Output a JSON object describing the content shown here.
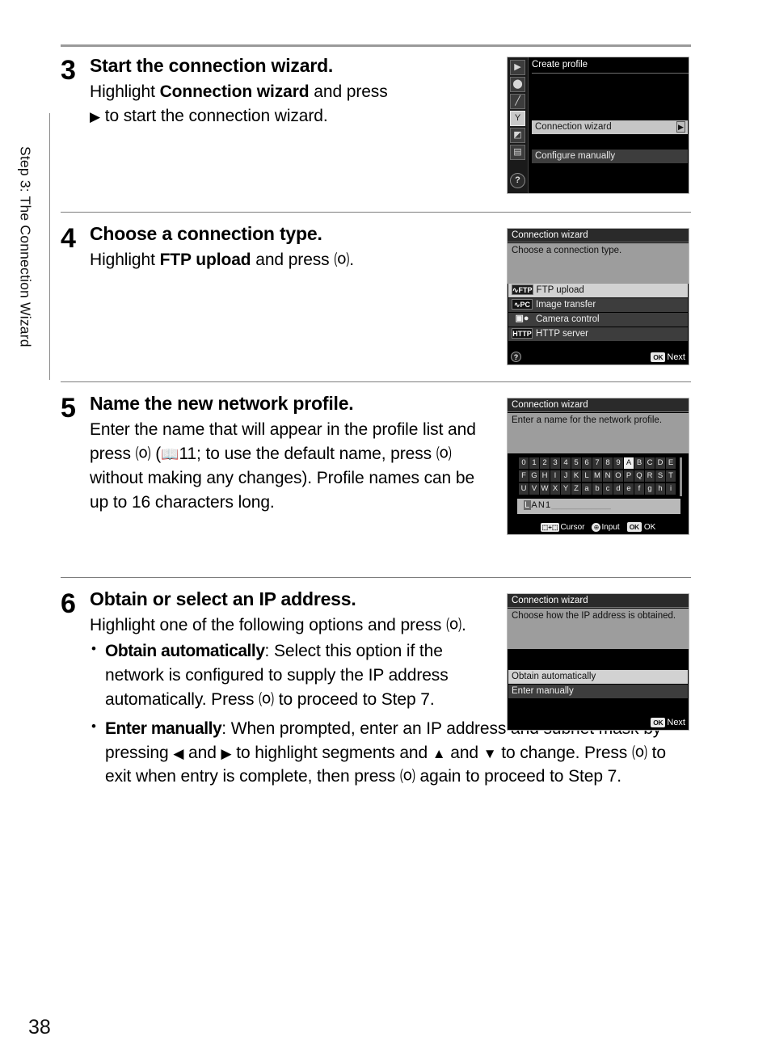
{
  "page": {
    "number": "38",
    "side_tab": "Step 3: The Connection Wizard"
  },
  "steps": [
    {
      "number": "3",
      "title": "Start the connection wizard.",
      "body_prefix": "Highlight ",
      "body_bold": "Connection wizard",
      "body_suffix": " and press ",
      "body_line2_arrow": "▶",
      "body_line2": " to start the connection wizard."
    },
    {
      "number": "4",
      "title": "Choose a connection type.",
      "body_prefix": "Highlight ",
      "body_bold": "FTP upload",
      "body_suffix": " and press ",
      "body_ok": "⒪",
      "body_end": "."
    },
    {
      "number": "5",
      "title": "Name the new network profile.",
      "body_1": "Enter the name that will appear in the profile list and press ",
      "body_ok1": "⒪",
      "body_2": " (",
      "book_icon": "📖",
      "page_ref": "11; to use the default name, press ",
      "body_ok2": "⒪",
      "body_3": " without making any changes). Profile names can be up to 16 characters long."
    },
    {
      "number": "6",
      "title": "Obtain or select an IP address.",
      "body_1": "Highlight one of the following options and press ",
      "body_ok": "⒪",
      "body_2": ".",
      "bullets": [
        {
          "label": "Obtain automatically",
          "text_1": ": Select this option if the network is configured to supply the IP address automatically. Press ",
          "ok": "⒪",
          "text_2": " to proceed to Step 7."
        },
        {
          "label": "Enter manually",
          "text_1": ": When prompted, enter an IP address and subnet mask by pressing ",
          "arrow_left": "◀",
          "text_2": " and ",
          "arrow_right": "▶",
          "text_3": " to highlight segments and ",
          "arrow_up": "▲",
          "text_4": " and ",
          "arrow_down": "▼",
          "text_5": " to change. Press ",
          "ok1": "⒪",
          "text_6": " to exit when entry is complete, then press ",
          "ok2": "⒪",
          "text_7": " again to proceed to Step 7."
        }
      ]
    }
  ],
  "screens": {
    "create_profile": {
      "header": "Create profile",
      "rail_icons": [
        "▶",
        "●",
        "╱",
        "⑁",
        "◧",
        "☷",
        "?"
      ],
      "items": [
        {
          "label": "Connection wizard",
          "state": "highlighted",
          "caret": "▶"
        },
        {
          "label": "Configure manually",
          "state": "dim"
        }
      ]
    },
    "connection_type": {
      "title": "Connection wizard",
      "prompt": "Choose a connection type.",
      "items": [
        {
          "badge": "∿FTP",
          "label": "FTP upload",
          "state": "highlighted"
        },
        {
          "badge": "∿PC",
          "label": "Image transfer",
          "state": "dim"
        },
        {
          "badge": "▣●",
          "label": "Camera control",
          "state": "dim"
        },
        {
          "badge": "HTTP",
          "label": "HTTP server",
          "state": "dim"
        }
      ],
      "footer": {
        "help": "?",
        "ok_pill": "OK",
        "ok_text": "Next"
      }
    },
    "name_profile": {
      "title": "Connection wizard",
      "prompt": "Enter a name for the network profile.",
      "keyboard_rows": [
        [
          "0",
          "1",
          "2",
          "3",
          "4",
          "5",
          "6",
          "7",
          "8",
          "9",
          "A",
          "B",
          "C",
          "D",
          "E"
        ],
        [
          "F",
          "G",
          "H",
          "I",
          "J",
          "K",
          "L",
          "M",
          "N",
          "O",
          "P",
          "Q",
          "R",
          "S",
          "T"
        ],
        [
          "U",
          "V",
          "W",
          "X",
          "Y",
          "Z",
          "a",
          "b",
          "c",
          "d",
          "e",
          "f",
          "g",
          "h",
          "i"
        ]
      ],
      "selected_key": "A",
      "input_cursor": "L",
      "input_value": "AN1",
      "input_dashes": "____________",
      "footer": {
        "cursor_pill": "⬚+⬚",
        "cursor_text": "Cursor",
        "input_btn": "⊕",
        "input_text": "Input",
        "ok_pill": "OK",
        "ok_text": "OK"
      }
    },
    "ip_address": {
      "title": "Connection wizard",
      "prompt": "Choose how the IP address is obtained.",
      "items": [
        {
          "label": "Obtain automatically",
          "state": "highlighted"
        },
        {
          "label": "Enter manually",
          "state": "dim"
        }
      ],
      "footer": {
        "ok_pill": "OK",
        "ok_text": "Next"
      }
    }
  }
}
